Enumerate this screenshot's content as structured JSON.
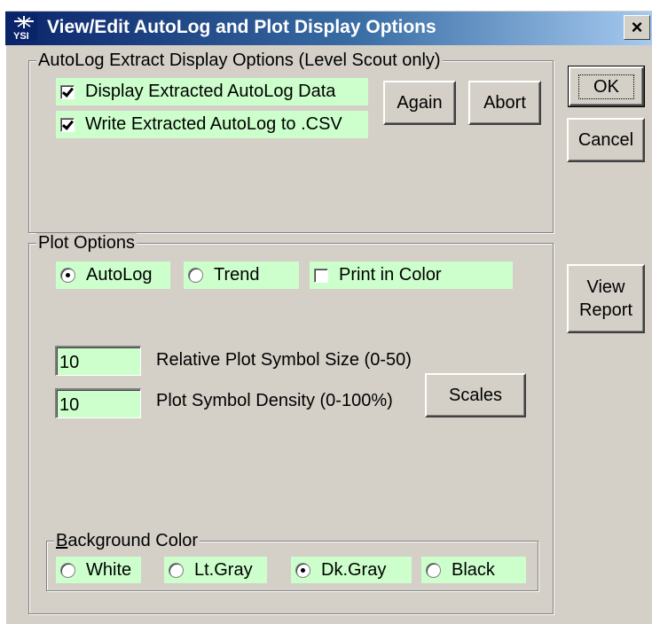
{
  "window": {
    "title": "View/Edit AutoLog and Plot Display Options",
    "close_label": "×",
    "icon": "ysi-app-icon"
  },
  "autolog_group": {
    "legend": "AutoLog Extract Display Options (Level Scout only)",
    "display_extracted": {
      "label": "Display Extracted AutoLog Data",
      "checked": true
    },
    "write_csv": {
      "label": "Write Extracted AutoLog to .CSV",
      "checked": true
    },
    "again_label": "Again",
    "abort_label": "Abort"
  },
  "side_buttons": {
    "ok_label": "OK",
    "cancel_label": "Cancel",
    "view_report_line1": "View",
    "view_report_line2": "Report"
  },
  "plot_group": {
    "legend": "Plot Options",
    "autolog_radio": {
      "label": "AutoLog",
      "selected": true
    },
    "trend_radio": {
      "label": "Trend",
      "selected": false
    },
    "print_color": {
      "label": "Print in Color",
      "checked": false
    },
    "symbol_size": {
      "value": "10",
      "label": "Relative Plot Symbol Size (0-50)"
    },
    "symbol_density": {
      "value": "10",
      "label": "Plot Symbol Density (0-100%)"
    },
    "scales_label": "Scales"
  },
  "background_group": {
    "legend_prefix": "B",
    "legend_rest": "ackground Color",
    "options": [
      {
        "label": "White",
        "selected": false
      },
      {
        "label": "Lt.Gray",
        "selected": false
      },
      {
        "label": "Dk.Gray",
        "selected": true
      },
      {
        "label": "Black",
        "selected": false
      }
    ]
  },
  "colors": {
    "field_bg": "#ccffcc",
    "dialog_bg": "#d4d0c8",
    "title_start": "#0a246a",
    "title_end": "#a6caf0"
  }
}
